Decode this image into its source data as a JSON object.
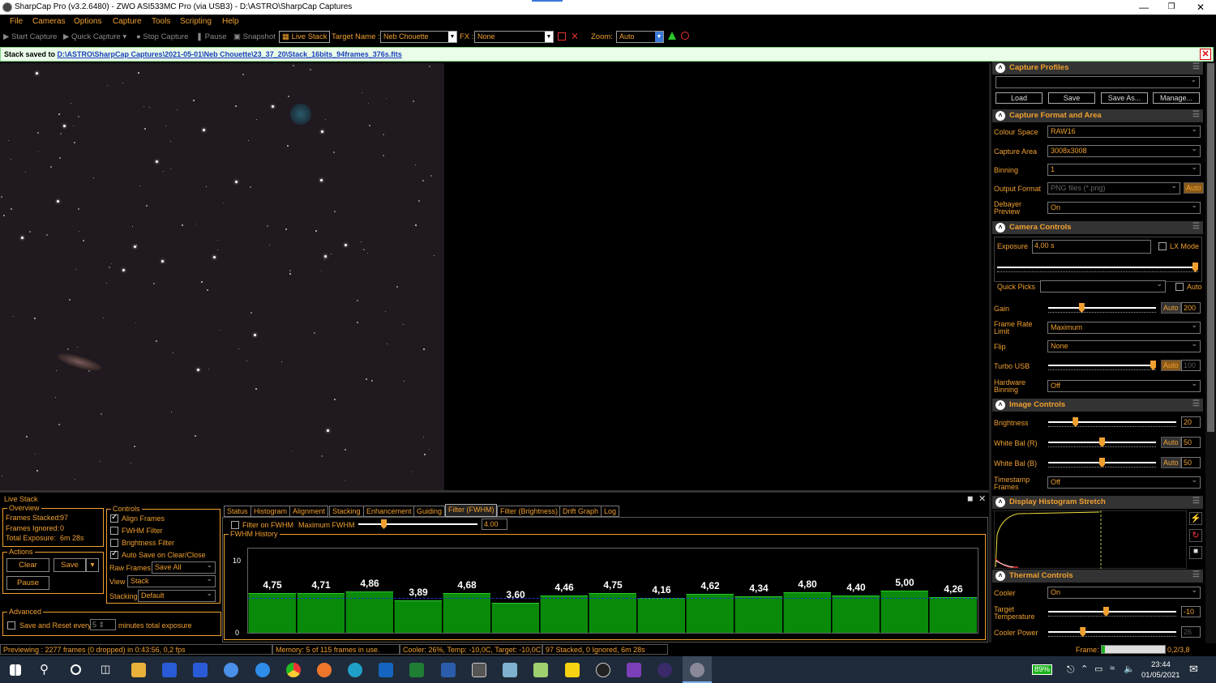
{
  "window": {
    "title": "SharpCap Pro (v3.2.6480) - ZWO ASI533MC Pro (via USB3) - D:\\ASTRO\\SharpCap Captures"
  },
  "menu": [
    "File",
    "Cameras",
    "Options",
    "Capture",
    "Tools",
    "Scripting",
    "Help"
  ],
  "toolbar": {
    "start_capture": "Start Capture",
    "quick_capture": "Quick Capture",
    "stop_capture": "Stop Capture",
    "pause": "Pause",
    "snapshot": "Snapshot",
    "live_stack": "Live Stack",
    "target_name_label": "Target Name :",
    "target_name_value": "Neb Chouette",
    "fx_label": "FX :",
    "fx_value": "None",
    "zoom_label": "Zoom:",
    "zoom_value": "Auto"
  },
  "notification": {
    "prefix": "Stack saved to",
    "path": "D:\\ASTRO\\SharpCap Captures\\2021-05-01\\Neb Chouette\\23_37_20\\Stack_16bits_94frames_376s.fits"
  },
  "rightpanel": {
    "capture_profiles": {
      "title": "Capture Profiles",
      "load": "Load",
      "save": "Save",
      "save_as": "Save As...",
      "manage": "Manage..."
    },
    "capture_format": {
      "title": "Capture Format and Area",
      "colour_space_label": "Colour Space",
      "colour_space": "RAW16",
      "capture_area_label": "Capture Area",
      "capture_area": "3008x3008",
      "binning_label": "Binning",
      "binning": "1",
      "output_format_label": "Output Format",
      "output_format": "PNG files (*.png)",
      "output_auto": "Auto",
      "debayer_label_1": "Debayer",
      "debayer_label_2": "Preview",
      "debayer": "On"
    },
    "camera_controls": {
      "title": "Camera Controls",
      "exposure_label": "Exposure",
      "exposure": "4,00 s",
      "lx_mode": "LX Mode",
      "quick_picks_label": "Quick Picks",
      "auto": "Auto",
      "gain_label": "Gain",
      "gain_value": "200",
      "gain_level": 0.3,
      "frame_rate_label_1": "Frame Rate",
      "frame_rate_label_2": "Limit",
      "frame_rate": "Maximum",
      "flip_label": "Flip",
      "flip": "None",
      "turbo_label": "Turbo USB",
      "turbo_value": "100",
      "turbo_level": 1.0,
      "hw_bin_label_1": "Hardware",
      "hw_bin_label_2": "Binning",
      "hw_bin": "Off",
      "exposure_level": 1.0
    },
    "image_controls": {
      "title": "Image Controls",
      "brightness_label": "Brightness",
      "brightness_value": "20",
      "brightness_level": 0.2,
      "wb_r_label": "White Bal (R)",
      "wb_r_value": "50",
      "wb_r_level": 0.5,
      "wb_b_label": "White Bal (B)",
      "wb_b_value": "50",
      "wb_b_level": 0.5,
      "timestamp_label_1": "Timestamp",
      "timestamp_label_2": "Frames",
      "timestamp": "Off"
    },
    "histogram": {
      "title": "Display Histogram Stretch"
    },
    "thermal": {
      "title": "Thermal Controls",
      "cooler_label": "Cooler",
      "cooler": "On",
      "target_temp_label_1": "Target",
      "target_temp_label_2": "Temperature",
      "target_temp": "-10",
      "target_temp_level": 0.45,
      "cooler_power_label": "Cooler Power",
      "cooler_power": "26",
      "cooler_power_level": 0.26
    }
  },
  "livestack": {
    "title": "Live Stack",
    "overview_title": "Overview",
    "frames_stacked_label": "Frames Stacked:",
    "frames_stacked": "97",
    "frames_ignored_label": "Frames Ignored:",
    "frames_ignored": "0",
    "total_exposure_label": "Total Exposure:",
    "total_exposure": "6m 28s",
    "actions_title": "Actions",
    "clear": "Clear",
    "save": "Save",
    "pause": "Pause",
    "advanced_title": "Advanced",
    "save_reset_1": "Save and Reset every",
    "save_reset_value": "5",
    "save_reset_2": "minutes total exposure",
    "controls_title": "Controls",
    "align_frames": "Align Frames",
    "fwhm_filter": "FWHM Filter",
    "brightness_filter": "Brightness Filter",
    "auto_save": "Auto Save on Clear/Close",
    "raw_frames_label": "Raw Frames",
    "raw_frames": "Save All",
    "view_label": "View",
    "view": "Stack",
    "stacking_label": "Stacking",
    "stacking": "Default",
    "tabs": [
      "Status",
      "Histogram",
      "Alignment",
      "Stacking",
      "Enhancement",
      "Guiding",
      "Filter (FWHM)",
      "Filter (Brightness)",
      "Drift Graph",
      "Log"
    ],
    "filter_on_fwhm": "Filter on FWHM",
    "max_fwhm_label": "Maximum FWHM",
    "max_fwhm": "4.00",
    "max_fwhm_level": 0.2,
    "fwhm_history_title": "FWHM History",
    "y_max": "10",
    "y_min": "0"
  },
  "chart_data": {
    "type": "bar",
    "title": "FWHM History",
    "ylim": [
      0,
      10
    ],
    "values": [
      4.75,
      4.71,
      4.86,
      3.89,
      4.68,
      3.6,
      4.46,
      4.75,
      4.16,
      4.62,
      4.34,
      4.8,
      4.4,
      5.0,
      4.26
    ],
    "labels": [
      "4,75",
      "4,71",
      "4,86",
      "3,89",
      "4,68",
      "3,60",
      "4,46",
      "4,75",
      "4,16",
      "4,62",
      "4,34",
      "4,80",
      "4,40",
      "5,00",
      "4,26"
    ],
    "threshold": 4.0
  },
  "status": {
    "preview": "Previewing : 2277 frames (0 dropped) in 0:43:56, 0,2 fps",
    "memory": "Memory: 5 of 115 frames in use.",
    "cooler": "Cooler: 26%, Temp: -10,0C, Target: -10,0C",
    "stacked": "97 Stacked, 0 Ignored, 6m 28s",
    "frame_label": "Frame:",
    "frame_value": "0,2/3,8",
    "frame_level": 0.05
  },
  "taskbar": {
    "battery": "89%",
    "time": "23:44",
    "date": "01/05/2021"
  }
}
